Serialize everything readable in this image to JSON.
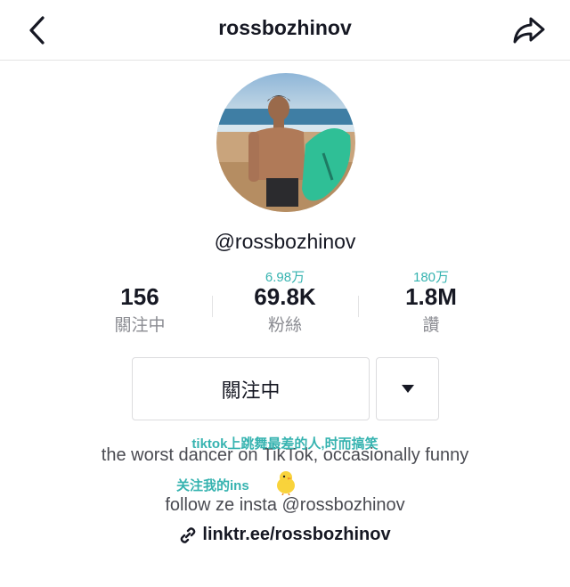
{
  "header": {
    "title": "rossbozhinov"
  },
  "profile": {
    "handle": "@rossbozhinov"
  },
  "stats": [
    {
      "overlay": "",
      "value": "156",
      "label": "關注中"
    },
    {
      "overlay": "6.98万",
      "value": "69.8K",
      "label": "粉絲"
    },
    {
      "overlay": "180万",
      "value": "1.8M",
      "label": "讚"
    }
  ],
  "actions": {
    "follow_label": "關注中"
  },
  "bio": {
    "overlay_line1": "tiktok上跳舞最差的人,时而搞笑",
    "line1": "the worst dancer on TikTok, occasionally funny",
    "overlay_line2": "关注我的ins",
    "line2": "follow ze insta @rossbozhinov",
    "link": "linktr.ee/rossbozhinov"
  },
  "icons": {
    "back": "chevron-left-icon",
    "share": "share-arrow-icon",
    "dropdown": "triangle-down-icon",
    "link": "link-icon",
    "emoji": "chick-emoji-icon"
  },
  "colors": {
    "text": "#161823",
    "muted": "#8a8b91",
    "translation": "#36b3b0",
    "border": "#dcdcde"
  }
}
